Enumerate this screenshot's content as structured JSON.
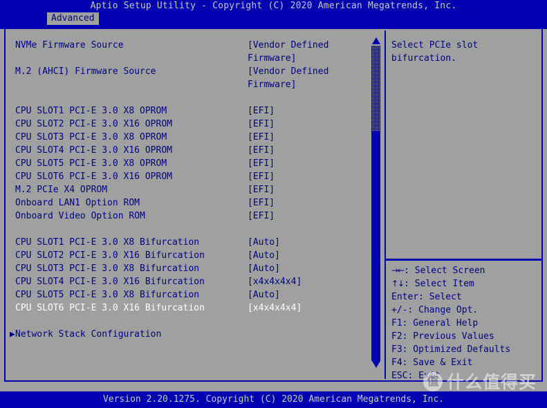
{
  "header": {
    "title": "Aptio Setup Utility - Copyright (C) 2020 American Megatrends, Inc.",
    "tabs": [
      {
        "label": "Advanced",
        "active": true
      }
    ]
  },
  "main": {
    "rows": [
      {
        "type": "item",
        "label": "NVMe Firmware Source",
        "value": "[Vendor Defined",
        "value2": "Firmware]",
        "selected": false,
        "submenu": false
      },
      {
        "type": "item",
        "label": "M.2 (AHCI) Firmware Source",
        "value": "[Vendor Defined",
        "value2": "Firmware]",
        "selected": false,
        "submenu": false
      },
      {
        "type": "spacer"
      },
      {
        "type": "item",
        "label": "CPU SLOT1 PCI-E 3.0 X8 OPROM",
        "value": "[EFI]",
        "selected": false,
        "submenu": false
      },
      {
        "type": "item",
        "label": "CPU SLOT2 PCI-E 3.0 X16 OPROM",
        "value": "[EFI]",
        "selected": false,
        "submenu": false
      },
      {
        "type": "item",
        "label": "CPU SLOT3 PCI-E 3.0 X8 OPROM",
        "value": "[EFI]",
        "selected": false,
        "submenu": false
      },
      {
        "type": "item",
        "label": "CPU SLOT4 PCI-E 3.0 X16 OPROM",
        "value": "[EFI]",
        "selected": false,
        "submenu": false
      },
      {
        "type": "item",
        "label": "CPU SLOT5 PCI-E 3.0 X8 OPROM",
        "value": "[EFI]",
        "selected": false,
        "submenu": false
      },
      {
        "type": "item",
        "label": "CPU SLOT6 PCI-E 3.0 X16 OPROM",
        "value": "[EFI]",
        "selected": false,
        "submenu": false
      },
      {
        "type": "item",
        "label": "M.2 PCIe X4 OPROM",
        "value": "[EFI]",
        "selected": false,
        "submenu": false
      },
      {
        "type": "item",
        "label": "Onboard LAN1 Option ROM",
        "value": "[EFI]",
        "selected": false,
        "submenu": false
      },
      {
        "type": "item",
        "label": "Onboard Video Option ROM",
        "value": "[EFI]",
        "selected": false,
        "submenu": false
      },
      {
        "type": "spacer"
      },
      {
        "type": "item",
        "label": "CPU SLOT1 PCI-E 3.0 X8 Bifurcation",
        "value": "[Auto]",
        "selected": false,
        "submenu": false
      },
      {
        "type": "item",
        "label": "CPU SLOT2 PCI-E 3.0 X16 Bifurcation",
        "value": "[Auto]",
        "selected": false,
        "submenu": false
      },
      {
        "type": "item",
        "label": "CPU SLOT3 PCI-E 3.0 X8 Bifurcation",
        "value": "[Auto]",
        "selected": false,
        "submenu": false
      },
      {
        "type": "item",
        "label": "CPU SLOT4 PCI-E 3.0 X16 Bifurcation",
        "value": "[x4x4x4x4]",
        "selected": false,
        "submenu": false
      },
      {
        "type": "item",
        "label": "CPU SLOT5 PCI-E 3.0 X8 Bifurcation",
        "value": "[Auto]",
        "selected": false,
        "submenu": false
      },
      {
        "type": "item",
        "label": "CPU SLOT6 PCI-E 3.0 X16 Bifurcation",
        "value": "[x4x4x4x4]",
        "selected": true,
        "submenu": false
      },
      {
        "type": "spacer"
      },
      {
        "type": "item",
        "label": "Network Stack Configuration",
        "value": "",
        "selected": false,
        "submenu": true,
        "bullet": "▶"
      }
    ]
  },
  "help": {
    "lines": [
      "Select PCIe slot",
      "bifurcation."
    ]
  },
  "keys": [
    {
      "glyph": "→←",
      "text": ": Select Screen"
    },
    {
      "glyph": "↑↓",
      "text": ": Select Item"
    },
    {
      "glyph": "",
      "text": "Enter: Select"
    },
    {
      "glyph": "",
      "text": "+/-: Change Opt."
    },
    {
      "glyph": "",
      "text": "F1: General Help"
    },
    {
      "glyph": "",
      "text": "F2: Previous Values"
    },
    {
      "glyph": "",
      "text": "F3: Optimized Defaults"
    },
    {
      "glyph": "",
      "text": "F4: Save & Exit"
    },
    {
      "glyph": "",
      "text": "ESC: Exit"
    }
  ],
  "footer": {
    "text": "Version 2.20.1275. Copyright (C) 2020 American Megatrends, Inc."
  },
  "watermark": {
    "badge": "值",
    "text": "什么值得买"
  },
  "colors": {
    "background_blue": "#0000b0",
    "panel_gray": "#a0a0a0",
    "text_blue": "#000080",
    "text_light": "#c8c8c8",
    "selected_text": "#ffffff"
  },
  "scrollbar": {
    "up_arrow": "▲",
    "down_arrow": "▼"
  }
}
